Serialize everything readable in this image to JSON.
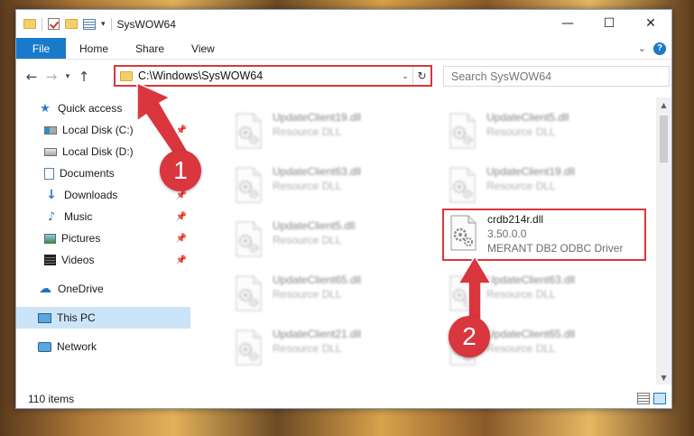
{
  "window": {
    "title": "SysWOW64",
    "controls": {
      "minimize": "—",
      "maximize": "☐",
      "close": "✕"
    }
  },
  "ribbon": {
    "tabs": [
      "File",
      "Home",
      "Share",
      "View"
    ]
  },
  "navigation": {
    "back": "←",
    "forward": "→",
    "recent": "▾",
    "up": "↑"
  },
  "address": {
    "path": "C:\\Windows\\SysWOW64",
    "dropdown": "⌄",
    "refresh": "↻"
  },
  "search": {
    "placeholder": "Search SysWOW64"
  },
  "sidebar": {
    "items": [
      {
        "label": "Quick access",
        "icon": "star-icon",
        "pinned": false
      },
      {
        "label": "Local Disk (C:)",
        "icon": "drive-icon",
        "pinned": true
      },
      {
        "label": "Local Disk (D:)",
        "icon": "drive-icon",
        "pinned": true
      },
      {
        "label": "Documents",
        "icon": "document-icon",
        "pinned": true
      },
      {
        "label": "Downloads",
        "icon": "download-icon",
        "pinned": true
      },
      {
        "label": "Music",
        "icon": "music-icon",
        "pinned": true
      },
      {
        "label": "Pictures",
        "icon": "pictures-icon",
        "pinned": true
      },
      {
        "label": "Videos",
        "icon": "videos-icon",
        "pinned": true
      },
      {
        "label": "OneDrive",
        "icon": "cloud-icon",
        "pinned": false
      },
      {
        "label": "This PC",
        "icon": "computer-icon",
        "pinned": false,
        "selected": true
      },
      {
        "label": "Network",
        "icon": "network-icon",
        "pinned": false
      }
    ],
    "pin_glyph": "📌"
  },
  "files": {
    "left_column": [
      {
        "name": "UpdateClient19.dll",
        "type": "Resource DLL"
      },
      {
        "name": "UpdateClient63.dll",
        "type": "Resource DLL"
      },
      {
        "name": "UpdateClient5.dll",
        "type": "Resource DLL"
      },
      {
        "name": "UpdateClient65.dll",
        "type": "Resource DLL"
      },
      {
        "name": "UpdateClient21.dll",
        "type": "Resource DLL"
      }
    ],
    "right_column": [
      {
        "name": "UpdateClient5.dll",
        "type": "Resource DLL"
      },
      {
        "name": "UpdateClient19.dll",
        "type": "Resource DLL"
      },
      {
        "name": "UpdateClient63.dll",
        "type": "Resource DLL"
      },
      {
        "name": "UpdateClient65.dll",
        "type": "Resource DLL"
      }
    ],
    "highlighted": {
      "name": "crdb214r.dll",
      "version": "3.50.0.0",
      "description": "MERANT DB2 ODBC Driver"
    }
  },
  "status": {
    "item_count": "110 items"
  },
  "annotations": {
    "step1": "1",
    "step2": "2",
    "color": "#d9363e"
  },
  "colors": {
    "accent": "#1979ca",
    "selection": "#cce4f7",
    "highlight_border": "#d9363e"
  }
}
